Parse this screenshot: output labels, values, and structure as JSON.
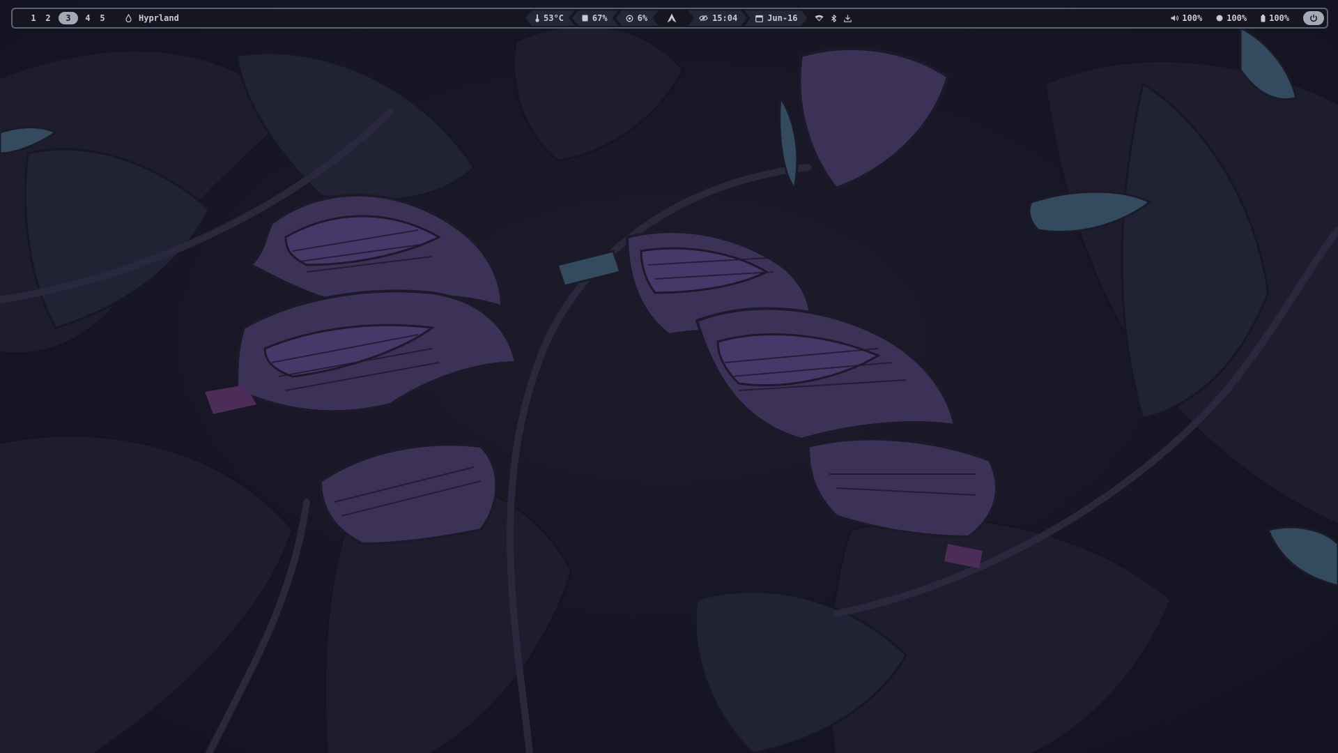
{
  "topbar": {
    "workspaces": [
      {
        "label": "1",
        "active": false
      },
      {
        "label": "2",
        "active": false
      },
      {
        "label": "3",
        "active": true
      },
      {
        "label": "4",
        "active": false
      },
      {
        "label": "5",
        "active": false
      }
    ],
    "window_title": "Hyprland",
    "center": {
      "temperature": "53°C",
      "memory": "67%",
      "cpu": "6%",
      "clock": "15:04",
      "date": "Jun-16"
    },
    "right": {
      "volume": "100%",
      "brightness": "100%",
      "battery": "100%"
    }
  },
  "icons": {
    "window_title": "drop-icon",
    "temperature": "thermometer-icon",
    "memory": "memory-icon",
    "cpu": "cpu-icon",
    "logo": "arch-logo-icon",
    "clock": "eye-icon",
    "date": "calendar-icon",
    "wifi": "wifi-icon",
    "bluetooth": "bluetooth-icon",
    "updates": "download-icon",
    "volume": "speaker-icon",
    "brightness": "brightness-icon",
    "battery": "battery-icon",
    "power": "power-icon"
  },
  "colors": {
    "bar_background": "#161620",
    "bar_border": "#5d6274",
    "text": "#c9cbd6",
    "active_workspace": "#a6a8b6",
    "segment": "#262736",
    "wallpaper_purple": "#4a3a6e",
    "wallpaper_teal": "#3d5468"
  }
}
